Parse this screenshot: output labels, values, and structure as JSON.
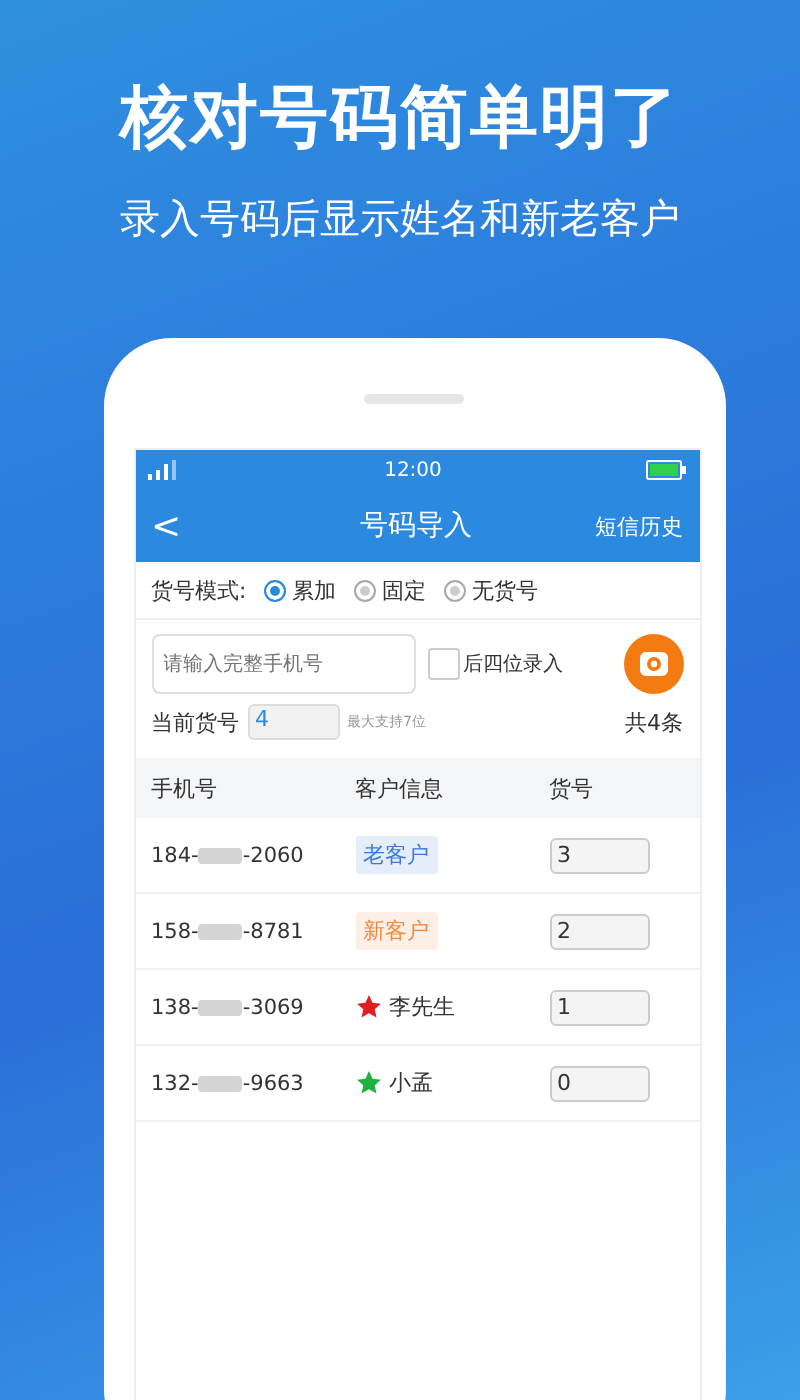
{
  "headline": "核对号码简单明了",
  "subtitle": "录入号码后显示姓名和新老客户",
  "status_bar": {
    "time": "12:00"
  },
  "nav": {
    "back": "<",
    "title": "号码导入",
    "action": "短信历史"
  },
  "mode": {
    "label": "货号模式:",
    "options": [
      {
        "label": "累加",
        "selected": true
      },
      {
        "label": "固定",
        "selected": false
      },
      {
        "label": "无货号",
        "selected": false
      }
    ]
  },
  "entry": {
    "placeholder": "请输入完整手机号",
    "last_four": {
      "label": "后四位录入",
      "checked": false
    }
  },
  "current": {
    "label": "当前货号",
    "value": "4",
    "hint": "最大支持7位",
    "total": "共4条"
  },
  "table": {
    "columns": [
      "手机号",
      "客户信息",
      "货号"
    ],
    "rows": [
      {
        "prefix": "184-",
        "suffix": "-2060",
        "customer": {
          "kind": "tag",
          "text": "老客户",
          "color": "#3a78e0"
        },
        "number": "3"
      },
      {
        "prefix": "158-",
        "suffix": "-8781",
        "customer": {
          "kind": "tag",
          "text": "新客户",
          "color": "#f08a3c"
        },
        "number": "2"
      },
      {
        "prefix": "138-",
        "suffix": "-3069",
        "customer": {
          "kind": "star",
          "text": "李先生",
          "color": "#e02020"
        },
        "number": "1"
      },
      {
        "prefix": "132-",
        "suffix": "-9663",
        "customer": {
          "kind": "star",
          "text": "小孟",
          "color": "#20b040"
        },
        "number": "0"
      }
    ]
  }
}
